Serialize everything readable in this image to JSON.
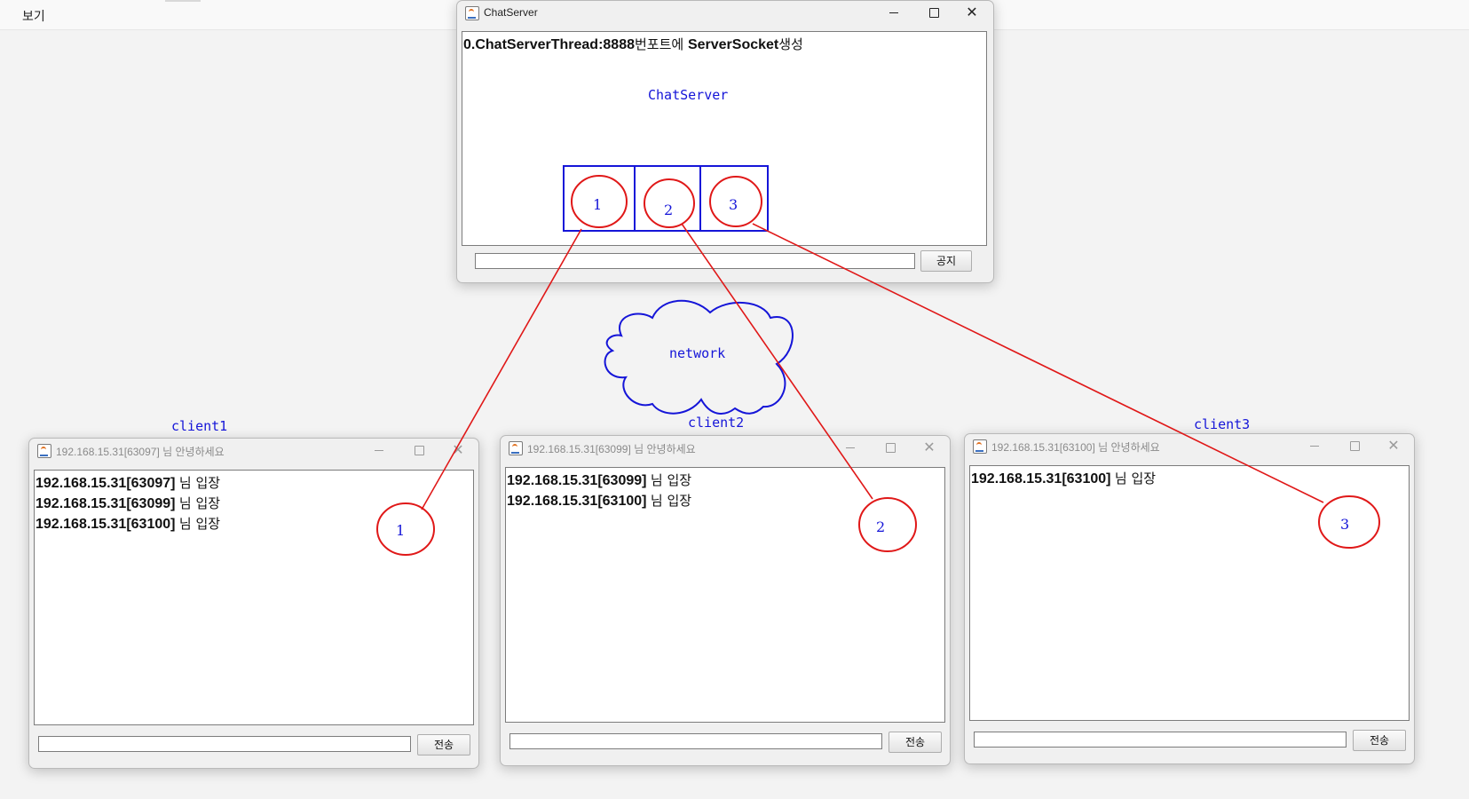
{
  "menubar": {
    "view_label": "보기"
  },
  "server_window": {
    "title": "ChatServer",
    "log_line_prefix": "0.ChatServerThread:8888",
    "log_line_kor1": "번포트에 ",
    "log_line_mid": "ServerSocket",
    "log_line_kor2": "생성",
    "input_value": "",
    "notice_button": "공지"
  },
  "client_windows": [
    {
      "title": "192.168.15.31[63097] 님 안녕하세요",
      "lines": [
        "192.168.15.31[63097]",
        "192.168.15.31[63099]",
        "192.168.15.31[63100]"
      ],
      "suffix": "님 입장",
      "input_value": "",
      "send_button": "전송"
    },
    {
      "title": "192.168.15.31[63099] 님 안녕하세요",
      "lines": [
        "192.168.15.31[63099]",
        "192.168.15.31[63100]"
      ],
      "suffix": "님 입장",
      "input_value": "",
      "send_button": "전송"
    },
    {
      "title": "192.168.15.31[63100] 님 안녕하세요",
      "lines": [
        "192.168.15.31[63100]"
      ],
      "suffix": "님 입장",
      "input_value": "",
      "send_button": "전송"
    }
  ],
  "annotations": {
    "server_label": "ChatServer",
    "network_label": "network",
    "client1_label": "client1",
    "client2_label": "client2",
    "client3_label": "client3",
    "slot_numbers": [
      "1",
      "2",
      "3"
    ],
    "client_numbers": [
      "1",
      "2",
      "3"
    ],
    "colors": {
      "pen_blue": "#1515d8",
      "pen_red": "#e01818"
    }
  }
}
